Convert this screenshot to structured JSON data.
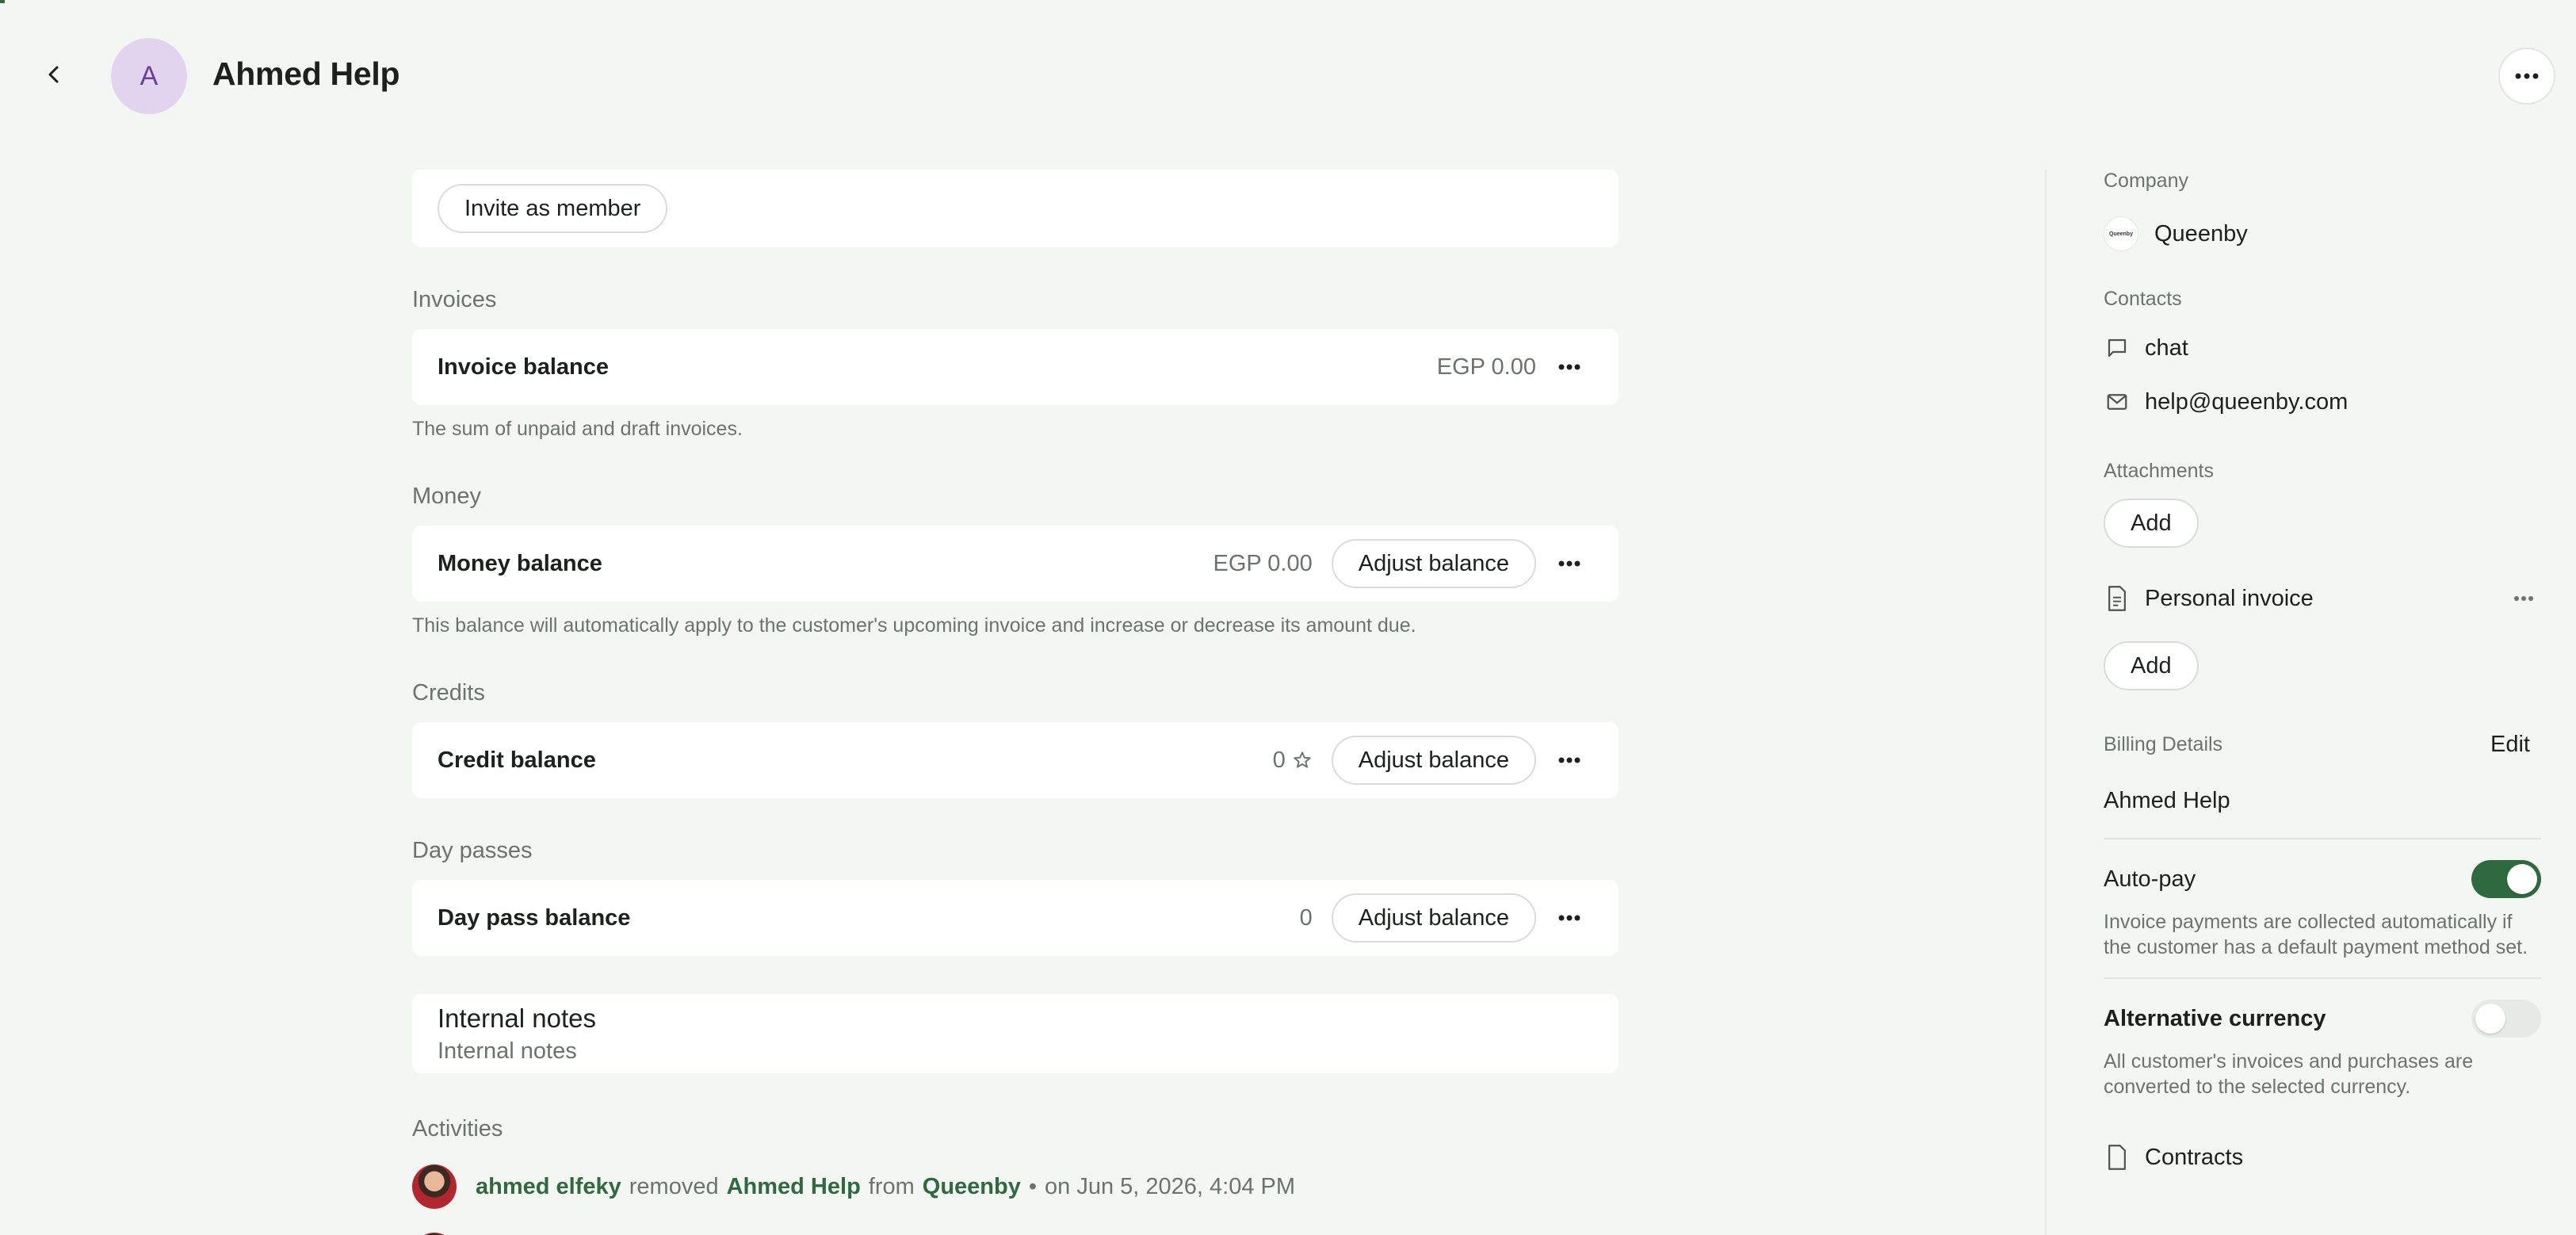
{
  "header": {
    "avatar_initial": "A",
    "title": "Ahmed Help"
  },
  "invite": {
    "label": "Invite as member"
  },
  "invoices": {
    "section": "Invoices",
    "title": "Invoice balance",
    "value": "EGP 0.00",
    "helper": "The sum of unpaid and draft invoices."
  },
  "money": {
    "section": "Money",
    "title": "Money balance",
    "value": "EGP 0.00",
    "adjust_label": "Adjust balance",
    "helper": "This balance will automatically apply to the customer's upcoming invoice and increase or decrease its amount due."
  },
  "credits": {
    "section": "Credits",
    "title": "Credit balance",
    "value": "0",
    "adjust_label": "Adjust balance"
  },
  "daypasses": {
    "section": "Day passes",
    "title": "Day pass balance",
    "value": "0",
    "adjust_label": "Adjust balance"
  },
  "notes": {
    "title": "Internal notes",
    "placeholder": "Internal notes"
  },
  "activities": {
    "section": "Activities",
    "items": [
      {
        "actor": "ahmed elfeky",
        "verb": "removed",
        "subject": "Ahmed Help",
        "prep": "from",
        "target": "Queenby",
        "bullet": "•",
        "when": "on Jun 5, 2026, 4:04 PM"
      }
    ]
  },
  "sidebar": {
    "company_label": "Company",
    "company_name": "Queenby",
    "company_logo_text": "Queenby",
    "contacts_label": "Contacts",
    "contact_chat": "chat",
    "contact_email": "help@queenby.com",
    "attachments_label": "Attachments",
    "attachments_add": "Add",
    "personal_invoice": "Personal invoice",
    "personal_add": "Add",
    "billing_label": "Billing Details",
    "billing_edit": "Edit",
    "billing_name": "Ahmed Help",
    "autopay_label": "Auto-pay",
    "autopay_on": true,
    "autopay_desc": "Invoice payments are collected automatically if the customer has a default payment method set.",
    "altcur_label": "Alternative currency",
    "altcur_on": false,
    "altcur_desc": "All customer's invoices and purchases are converted to the selected currency.",
    "contracts_label": "Contracts"
  },
  "colors": {
    "accent": "#2e6a3d",
    "avatar_bg": "#e2d3ee",
    "avatar_fg": "#6a3f97",
    "toggle_off": "#e6e9e6"
  }
}
